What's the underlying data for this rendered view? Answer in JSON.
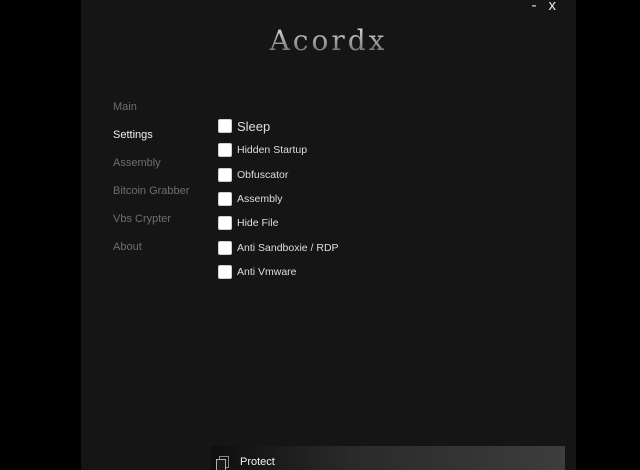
{
  "window": {
    "minimize_label": "-",
    "close_label": "x"
  },
  "app": {
    "logo_text": "Acordx"
  },
  "nav": {
    "items": [
      {
        "label": "Main"
      },
      {
        "label": "Settings",
        "active": true
      },
      {
        "label": "Assembly"
      },
      {
        "label": "Bitcoin Grabber"
      },
      {
        "label": "Vbs Crypter"
      },
      {
        "label": "About"
      }
    ]
  },
  "settings": {
    "options": [
      {
        "label": "Sleep",
        "checked": false
      },
      {
        "label": "Hidden Startup",
        "checked": false
      },
      {
        "label": "Obfuscator",
        "checked": false
      },
      {
        "label": "Assembly",
        "checked": false
      },
      {
        "label": "Hide File",
        "checked": false
      },
      {
        "label": "Anti Sandboxie / RDP",
        "checked": false
      },
      {
        "label": "Anti Vmware",
        "checked": false
      }
    ]
  },
  "footer": {
    "protect_label": "Protect",
    "protect_icon": "copy-icon"
  },
  "colors": {
    "window_bg": "#151515",
    "nav_active": "#f0f0f0",
    "nav_inactive": "#6e6e6e"
  }
}
